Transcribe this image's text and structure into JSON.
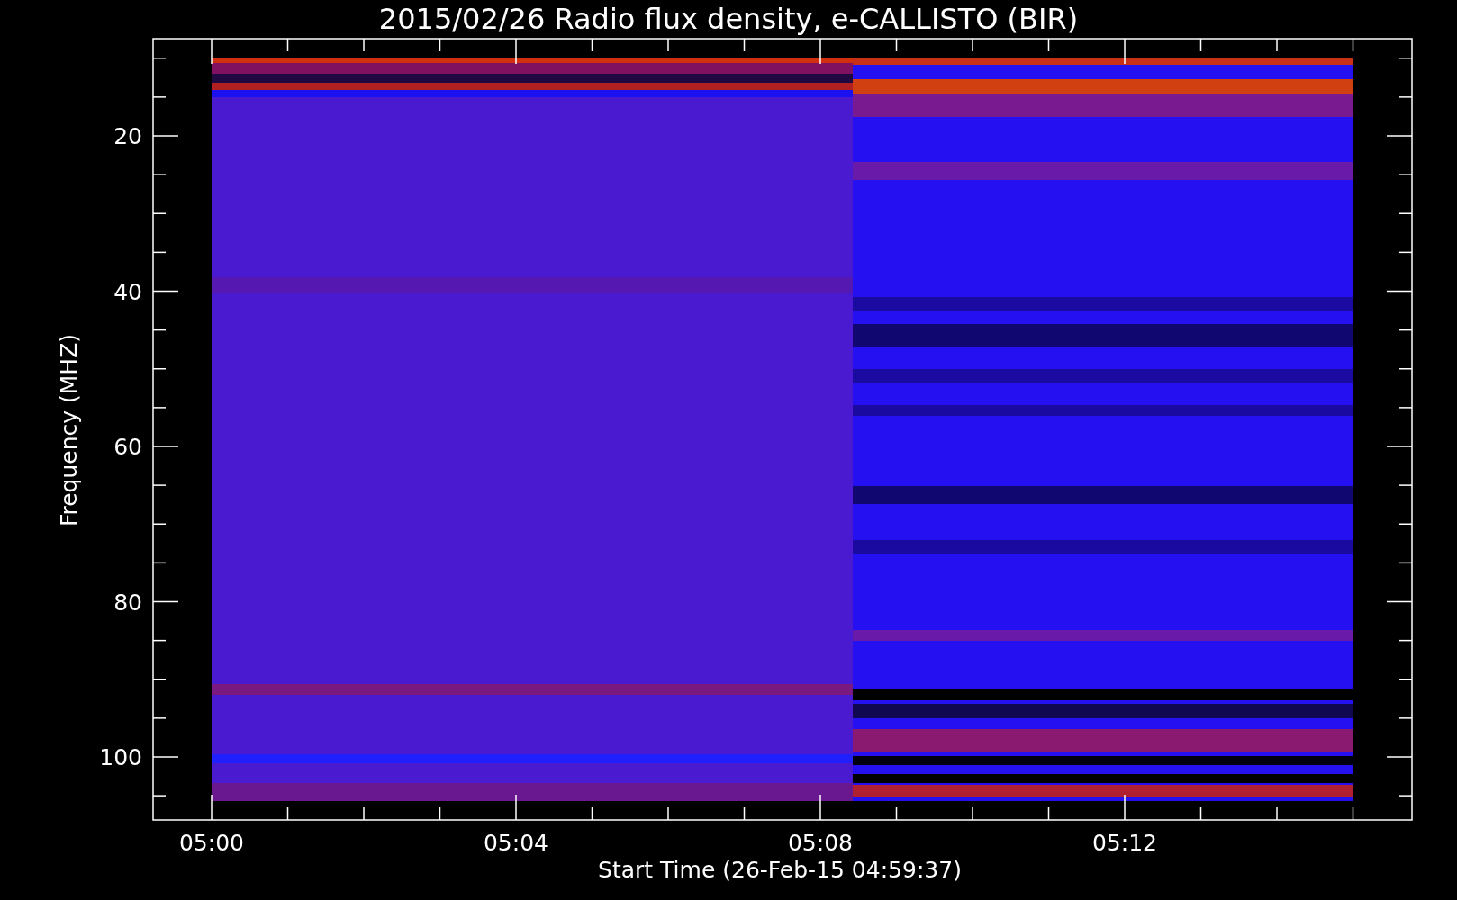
{
  "plot": {
    "title": "2015/02/26  Radio flux density, e-CALLISTO (BIR)",
    "y_axis": {
      "label": "Frequency (MHZ)",
      "ticks": [
        "20",
        "40",
        "60",
        "80",
        "100"
      ]
    },
    "x_axis": {
      "label": "Start Time (26-Feb-15 04:59:37)",
      "ticks": [
        "05:00",
        "05:04",
        "05:08",
        "05:12"
      ]
    }
  }
}
